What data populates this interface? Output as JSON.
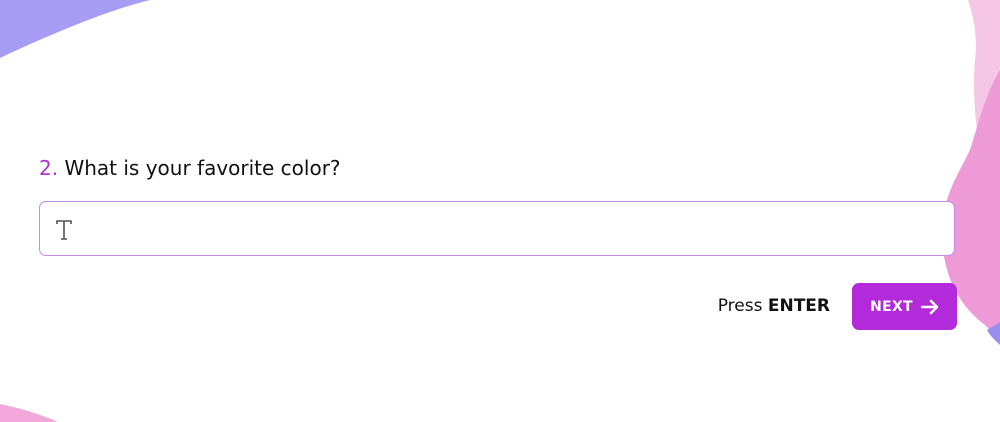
{
  "question": {
    "number": "2.",
    "text": "What is your favorite color?"
  },
  "answer": {
    "value": "",
    "placeholder": "",
    "icon": "text-type-icon"
  },
  "hint": {
    "prefix": "Press",
    "key": "ENTER"
  },
  "next_button": {
    "label": "NEXT",
    "icon": "arrow-right-icon"
  },
  "colors": {
    "accent": "#b22ad9",
    "input_border": "#c58ae6",
    "blob_left": "#9e96f3",
    "blob_right_pink": "#f09fd9",
    "blob_right_light": "#f4c4e4"
  }
}
